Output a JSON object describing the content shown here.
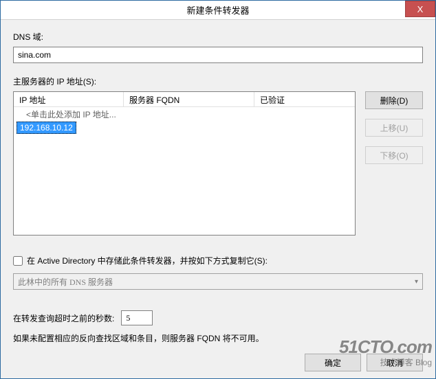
{
  "window": {
    "title": "新建条件转发器",
    "close": "X"
  },
  "dns_domain": {
    "label": "DNS 域:",
    "value": "sina.com"
  },
  "master_servers": {
    "label": "主服务器的 IP 地址(S):",
    "columns": {
      "ip": "IP 地址",
      "fqdn": "服务器 FQDN",
      "verified": "已验证"
    },
    "hint_row": "<单击此处添加 IP 地址...",
    "rows": [
      {
        "ip": "192.168.10.12",
        "fqdn": "",
        "verified": ""
      }
    ]
  },
  "buttons": {
    "delete": "删除(D)",
    "up": "上移(U)",
    "down": "下移(O)",
    "ok": "确定",
    "cancel": "取消"
  },
  "store_ad": {
    "label": "在 Active Directory 中存储此条件转发器，并按如下方式复制它(S):",
    "checked": false
  },
  "replication_combo": {
    "value": "此林中的所有 DNS 服务器"
  },
  "timeout": {
    "label": "在转发查询超时之前的秒数:",
    "value": "5"
  },
  "warning": "如果未配置相应的反向查找区域和条目，则服务器 FQDN 将不可用。",
  "watermark": {
    "main": "51CTO.com",
    "sub": "技术博客   Blog"
  }
}
